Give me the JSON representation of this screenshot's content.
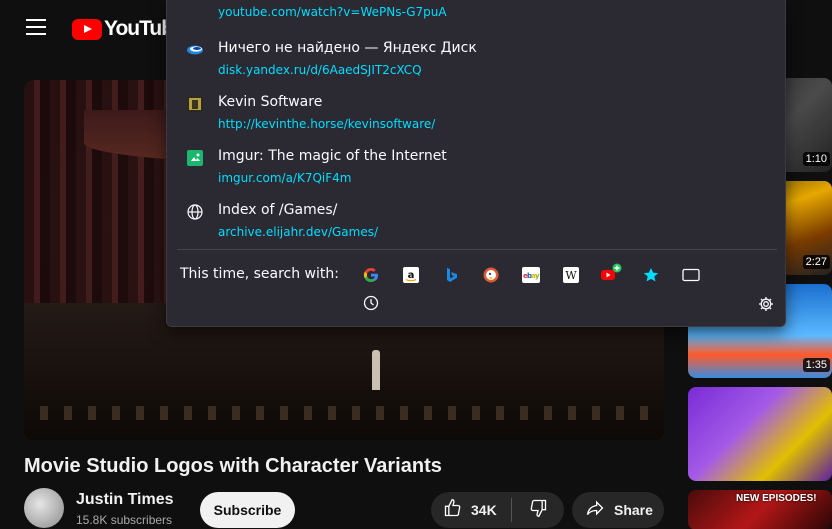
{
  "youtube": {
    "logo_text": "YouTube",
    "video_title": "Movie Studio Logos with Character Variants",
    "channel": {
      "name": "Justin Times",
      "subscribers": "15.8K subscribers"
    },
    "subscribe_label": "Subscribe",
    "like_count": "34K",
    "share_label": "Share",
    "sidebar": [
      {
        "duration": "1:10",
        "icon": "thumbnail"
      },
      {
        "duration": "2:27",
        "icon": "thumbnail"
      },
      {
        "duration": "1:35",
        "icon": "thumbnail"
      },
      {
        "duration": "",
        "icon": "thumbnail"
      },
      {
        "badge": "NEW EPISODES!",
        "icon": "thumbnail"
      }
    ]
  },
  "urlbar": {
    "results": [
      {
        "title": "",
        "url": "youtube.com/watch?v=WePNs-G7puA",
        "icon": "youtube-favicon"
      },
      {
        "title": "Ничего не найдено — Яндекс Диск",
        "url": "disk.yandex.ru/d/6AaedSJIT2cXCQ",
        "icon": "yandex-disk-icon"
      },
      {
        "title": "Kevin Software",
        "url": "http://kevinthe.horse/kevinsoftware/",
        "icon": "kevin-software-icon"
      },
      {
        "title": "Imgur: The magic of the Internet",
        "url": "imgur.com/a/K7QiF4m",
        "icon": "imgur-icon"
      },
      {
        "title": "Index of /Games/",
        "url": "archive.elijahr.dev/Games/",
        "icon": "globe-icon"
      }
    ],
    "one_off_label": "This time, search with:",
    "engines": [
      "google-icon",
      "amazon-icon",
      "bing-icon",
      "duckduckgo-icon",
      "ebay-icon",
      "wikipedia-icon",
      "youtube-add-icon",
      "bookmarks-icon",
      "tabs-icon",
      "history-icon"
    ],
    "settings_icon": "gear-icon",
    "colors": {
      "panel": "#2b2a33",
      "url": "#00ddff",
      "text": "#fbfbfe"
    }
  }
}
